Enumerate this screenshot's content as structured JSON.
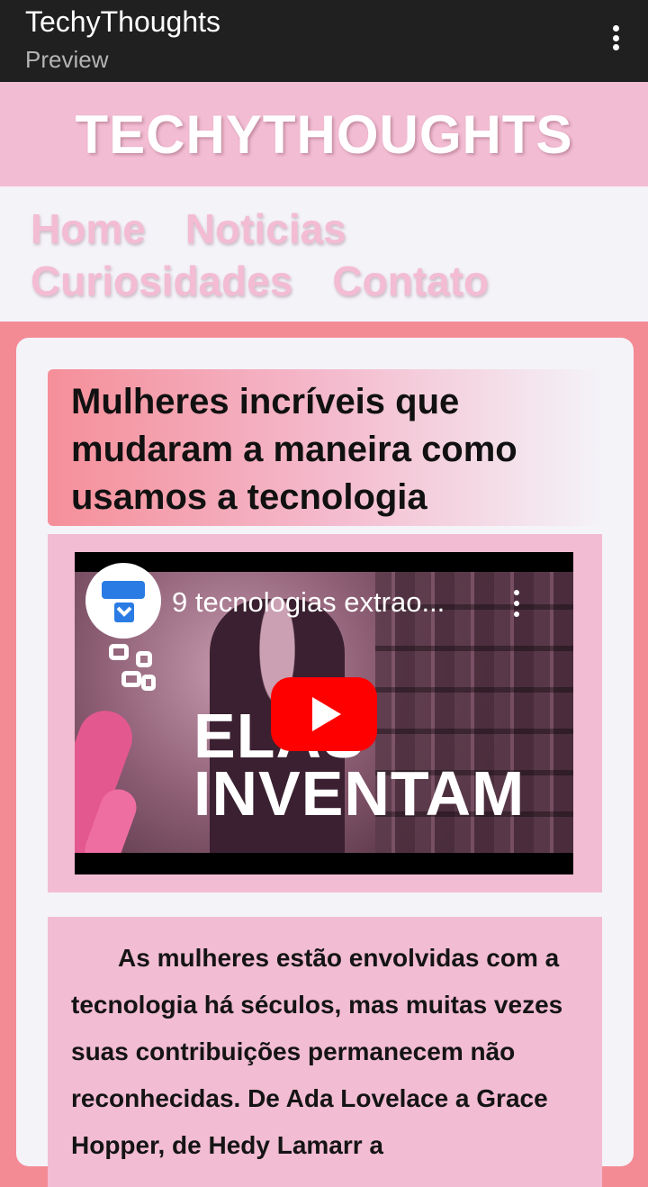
{
  "app_bar": {
    "title": "TechyThoughts",
    "subtitle": "Preview",
    "overflow_icon": "more-vert-icon"
  },
  "site": {
    "title": "TECHYTHOUGHTS",
    "nav": [
      "Home",
      "Noticias",
      "Curiosidades",
      "Contato"
    ]
  },
  "article": {
    "title": "Mulheres incríveis que mudaram a maneira como usamos a tecnologia",
    "video": {
      "title": "9 tecnologias extrao...",
      "overlay_line1": "ELAS",
      "overlay_line2": "INVENTAM",
      "play_icon": "youtube-play-icon"
    },
    "body": "As mulheres estão envolvidas com a tecnologia há séculos, mas muitas vezes suas contribuições permanecem não reconhecidas. De Ada Lovelace a Grace Hopper, de Hedy Lamarr a"
  },
  "colors": {
    "app_bar": "#202020",
    "header": "#f2bcd2",
    "page_bg": "#f38b95",
    "card": "#f4f3f8",
    "play_red": "#ff0000"
  }
}
